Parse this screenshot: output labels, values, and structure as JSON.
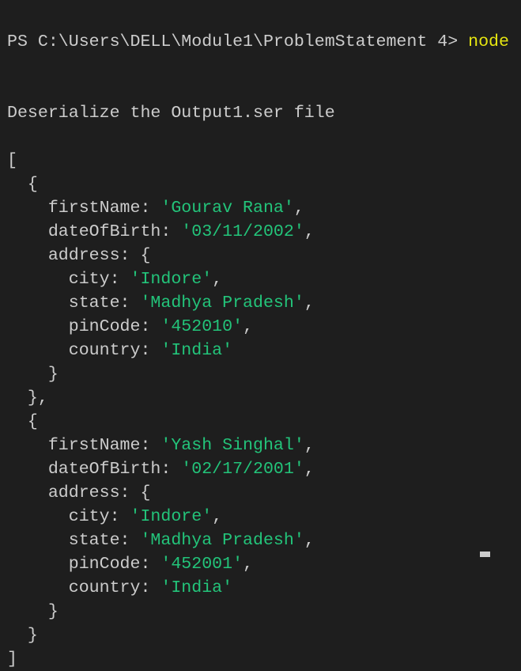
{
  "terminal": {
    "prompt_line": {
      "prompt": "PS C:\\Users\\DELL\\Module1\\ProblemStatement 4> ",
      "command": "node"
    },
    "message": "Deserialize the Output1.ser file",
    "records": [
      {
        "firstName": "'Gourav Rana'",
        "dateOfBirth": "'03/11/2002'",
        "address": {
          "city": "'Indore'",
          "state": "'Madhya Pradesh'",
          "pinCode": "'452010'",
          "country": "'India'"
        }
      },
      {
        "firstName": "'Yash Singhal'",
        "dateOfBirth": "'02/17/2001'",
        "address": {
          "city": "'Indore'",
          "state": "'Madhya Pradesh'",
          "pinCode": "'452001'",
          "country": "'India'"
        }
      }
    ]
  },
  "colors": {
    "background": "#1e1e1e",
    "text": "#cccccc",
    "string": "#23c47a",
    "command": "#e5e510"
  }
}
